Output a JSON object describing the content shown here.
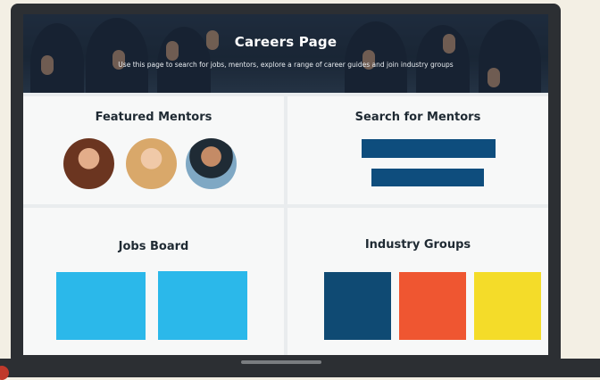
{
  "hero": {
    "title": "Careers Page",
    "subtitle": "Use this page to search for jobs, mentors, explore a range of career guides and join industry groups"
  },
  "panels": {
    "featured_mentors": {
      "title": "Featured Mentors"
    },
    "search_mentors": {
      "title": "Search for Mentors"
    },
    "jobs_board": {
      "title": "Jobs Board"
    },
    "industry_groups": {
      "title": "Industry Groups"
    }
  },
  "colors": {
    "search_bars": "#0e4d7d",
    "job_tiles": "#2bb8ea",
    "group_tiles": [
      "#0f4a73",
      "#ef5631",
      "#f4dc29"
    ]
  },
  "icons": [
    "mentor-avatar-woman",
    "mentor-avatar-blonde-woman",
    "mentor-avatar-man"
  ]
}
